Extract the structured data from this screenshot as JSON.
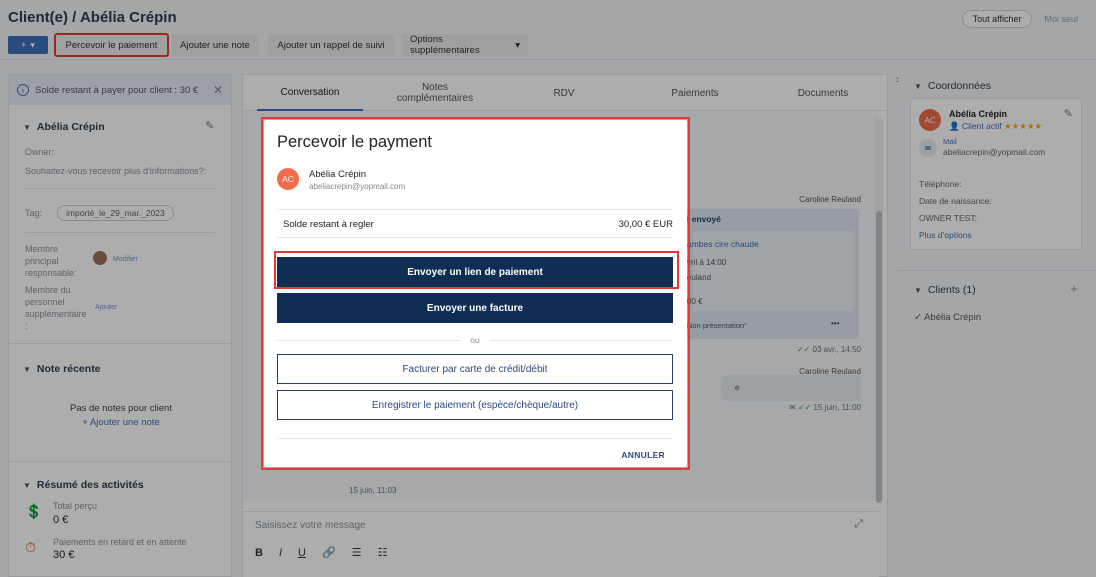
{
  "header": {
    "title": "Client(e) / Abélia Crépin",
    "plus_label": "+",
    "buttons": [
      "Percevoir le paiement",
      "Ajouter une note",
      "Ajouter un rappel de suivi",
      "Options supplémentaires"
    ],
    "view_all": "Tout afficher",
    "view_mine": "Moi seul"
  },
  "left": {
    "banner": "Solde restant à payer pour client : 30 €",
    "client_name": "Abélia Crépin",
    "owner_label": "Owner:",
    "question": "Souhaitez-vous recevoir plus d'informations?:",
    "tag_label": "Tag:",
    "tag_value": "importé_le_29_mar._2023",
    "main_member_label": "Membre principal responsable:",
    "modify": "Modifier",
    "extra_staff_label": "Membre du personnel supplémentaire :",
    "add": "Ajouter",
    "recent_note_title": "Note récente",
    "no_notes": "Pas de notes pour client",
    "add_note": "+ Ajouter une note",
    "activity_title": "Résumé des activités",
    "total_label": "Total perçu",
    "total_value": "0 €",
    "late_label": "Paiements en retard et en attente",
    "late_value": "30 €"
  },
  "tabs": [
    "Conversation",
    "Notes complémentaires",
    "RDV",
    "Paiements",
    "Documents"
  ],
  "conversation": {
    "sender1": "Caroline Reuland",
    "card_title": "i envoyé",
    "card_service": "ambes cire chaude",
    "card_date": "vril à 14:00",
    "card_staff": "euland",
    "card_amount": "00 €",
    "card_status": "Non présentation\"",
    "card_more": "•••",
    "time1": "03 avr., 14:50",
    "sender2": "Caroline Reuland",
    "bubble_text": "e",
    "time2": "15 juin, 11:00",
    "time3": "15 juin, 11:03",
    "composer_placeholder": "Saisissez votre message",
    "format_tools": [
      "B",
      "I",
      "U",
      "🔗",
      "☰",
      "☷"
    ]
  },
  "right": {
    "coord_title": "Coordonnées",
    "name": "Abélia Crépin",
    "initials": "AC",
    "status": "Client actif",
    "stars": "★★★★★",
    "mail_label": "Mail",
    "email": "abeliacrepin@yopmail.com",
    "phone_label": "Téléphone:",
    "birth_label": "Date de naissance:",
    "owner_test": "OWNER TEST:",
    "more_options": "Plus d'options",
    "clients_title": "Clients (1)",
    "client_item": "Abélia Crépin"
  },
  "modal": {
    "title": "Percevoir le payment",
    "initials": "AC",
    "name": "Abélia Crépin",
    "email": "abeliacrepin@yopmail.com",
    "balance_label": "Solde restant à regler",
    "balance_value": "30,00 € EUR",
    "btn_send_link": "Envoyer un lien de paiement",
    "btn_send_invoice": "Envoyer une facture",
    "or": "ou",
    "btn_card": "Facturer par carte de crédit/débit",
    "btn_record": "Enregistrer le paiement (espèce/chèque/autre)",
    "cancel": "ANNULER"
  },
  "colors": {
    "accent": "#3d6fb6",
    "navy": "#0f2d55",
    "highlight": "#e53935",
    "avatar": "#f26b4b"
  }
}
